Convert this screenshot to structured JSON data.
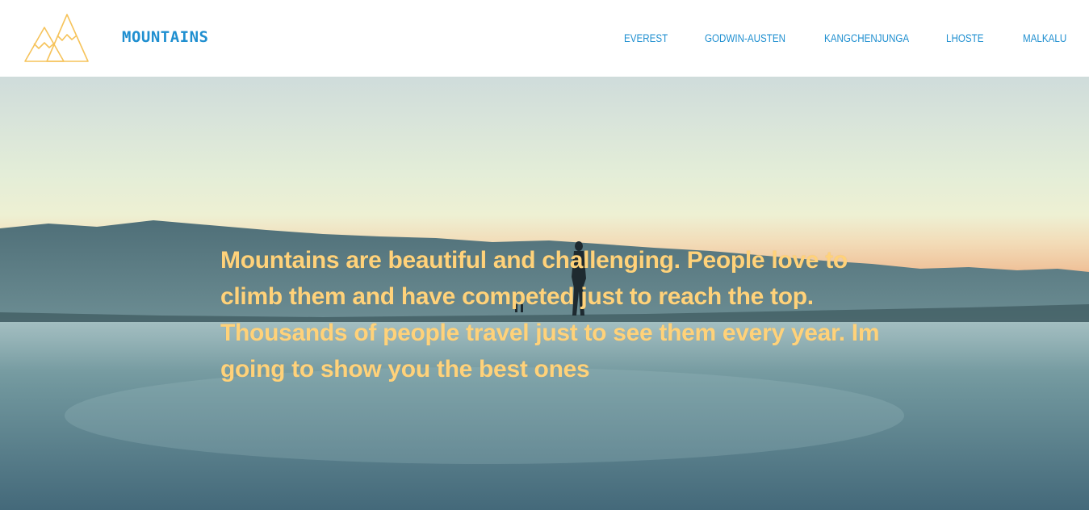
{
  "header": {
    "brand": "MOUNTAINS",
    "logo_icon": "mountains-logo-icon"
  },
  "nav": {
    "items": [
      {
        "label": "EVEREST"
      },
      {
        "label": "GODWIN-AUSTEN"
      },
      {
        "label": "KANGCHENJUNGA"
      },
      {
        "label": "LHOSTE"
      },
      {
        "label": "MALKALU"
      }
    ]
  },
  "hero": {
    "text": "Mountains are beautiful and challenging. People love to climb them and have competed just to reach the top. Thousands of people travel just to see them every year. Im going to show you the best ones"
  },
  "colors": {
    "nav_link": "#1f8fd0",
    "brand": "#1f8fd0",
    "logo": "#f6c35a",
    "hero_text": "#ffd27a"
  }
}
